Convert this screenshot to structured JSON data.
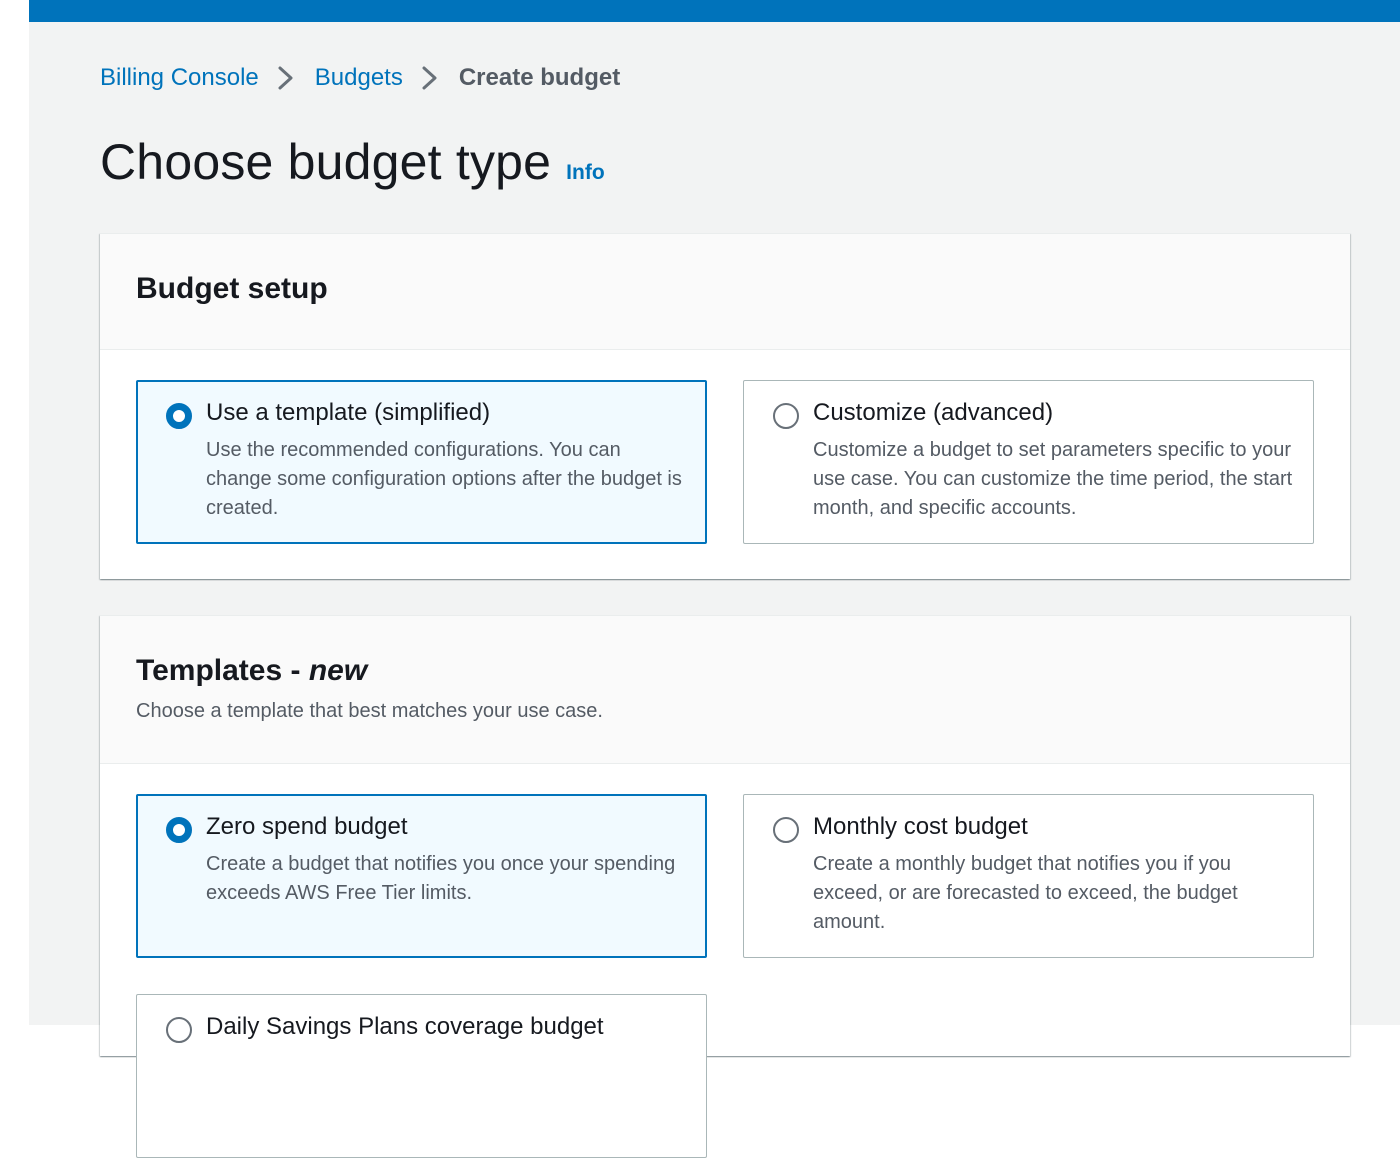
{
  "breadcrumb": {
    "items": [
      {
        "label": "Billing Console"
      },
      {
        "label": "Budgets"
      },
      {
        "label": "Create budget"
      }
    ]
  },
  "page": {
    "title": "Choose budget type",
    "info_link": "Info"
  },
  "budget_setup": {
    "title": "Budget setup",
    "options": [
      {
        "label": "Use a template (simplified)",
        "description": "Use the recommended configurations. You can change some configuration options after the budget is created.",
        "selected": true
      },
      {
        "label": "Customize (advanced)",
        "description": "Customize a budget to set parameters specific to your use case. You can customize the time period, the start month, and specific accounts.",
        "selected": false
      }
    ]
  },
  "templates": {
    "title": "Templates - ",
    "title_emphasis": "new",
    "description": "Choose a template that best matches your use case.",
    "options": [
      {
        "label": "Zero spend budget",
        "description": "Create a budget that notifies you once your spending exceeds AWS Free Tier limits.",
        "selected": true
      },
      {
        "label": "Monthly cost budget",
        "description": "Create a monthly budget that notifies you if you exceed, or are forecasted to exceed, the budget amount.",
        "selected": false
      },
      {
        "label": "Daily Savings Plans coverage budget",
        "description": "",
        "selected": false
      }
    ]
  },
  "colors": {
    "accent": "#0073bb",
    "selected_bg": "#f1faff",
    "page_bg": "#f2f3f3",
    "border": "#aab7b8"
  }
}
